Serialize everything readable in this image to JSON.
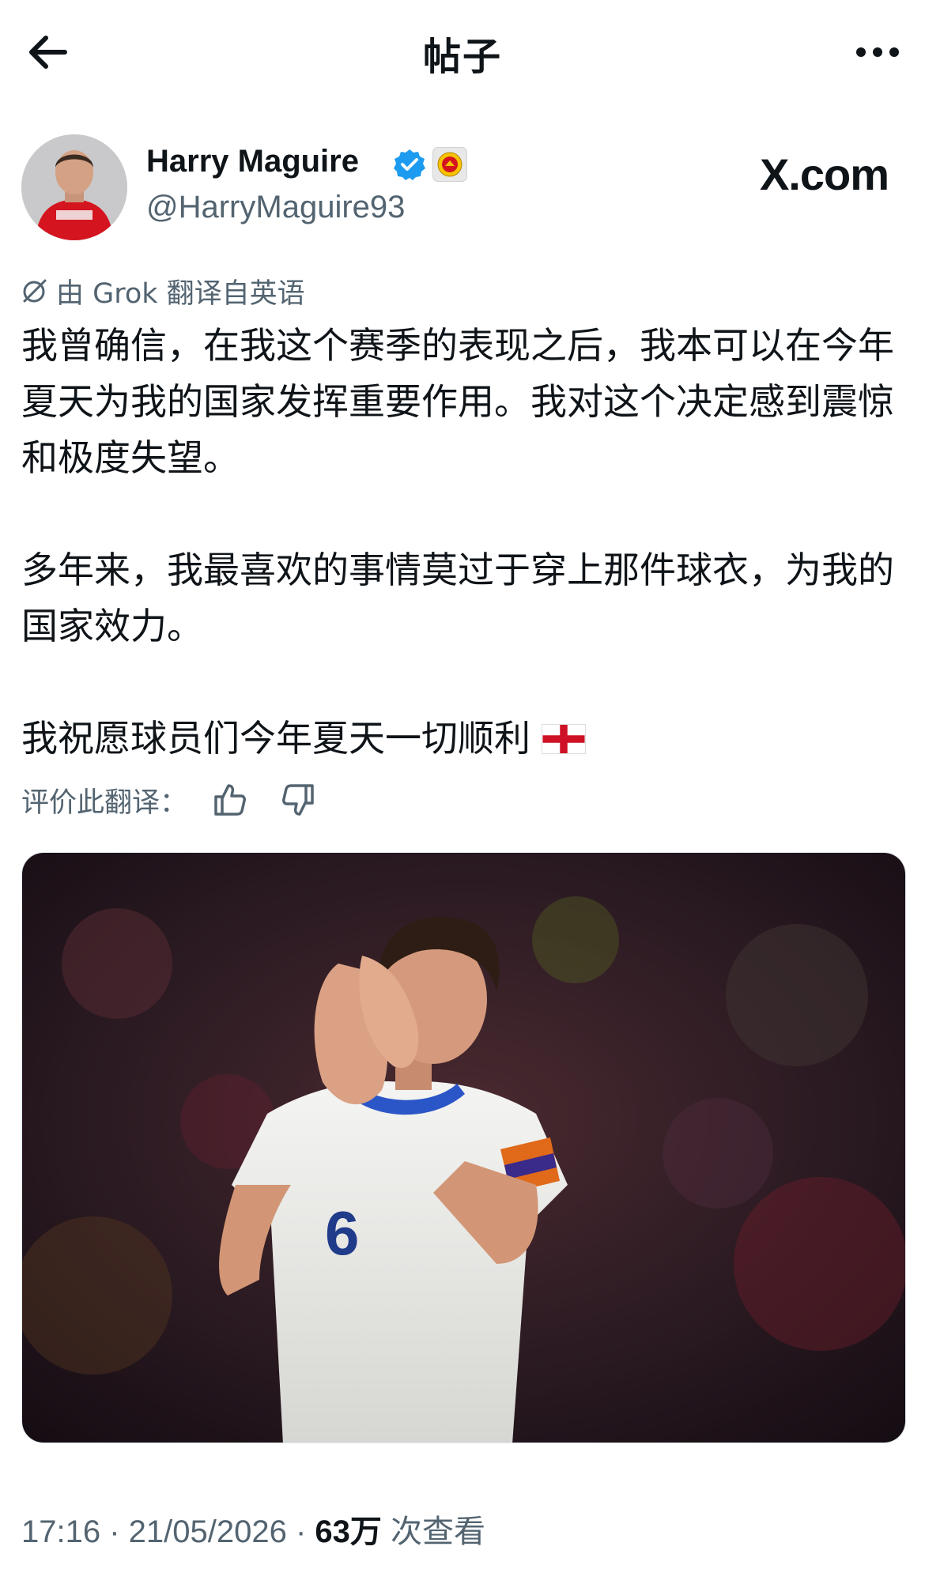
{
  "header": {
    "title": "帖子",
    "back_icon": "arrow-left-icon",
    "more_icon": "more-horizontal-icon"
  },
  "author": {
    "name": "Harry Maguire",
    "handle": "@HarryMaguire93",
    "verified_color": "#1d9bf0",
    "affiliation_badge": "manchester-united-crest"
  },
  "watermark": "X.com",
  "translation": {
    "note": "由 Grok 翻译自英语",
    "rate_label": "评价此翻译："
  },
  "post": {
    "paragraph1": "我曾确信，在我这个赛季的表现之后，我本可以在今年夏天为我的国家发挥重要作用。我对这个决定感到震惊和极度失望。",
    "paragraph2": "多年来，我最喜欢的事情莫过于穿上那件球衣，为我的国家效力。",
    "paragraph3": "我祝愿球员们今年夏天一切顺利",
    "emoji": "england-flag"
  },
  "meta": {
    "time": "17:16 · 21/05/2026 · ",
    "views_count": "63万",
    "views_label": " 次查看"
  },
  "colors": {
    "text": "#0f1419",
    "secondary": "#536471"
  }
}
